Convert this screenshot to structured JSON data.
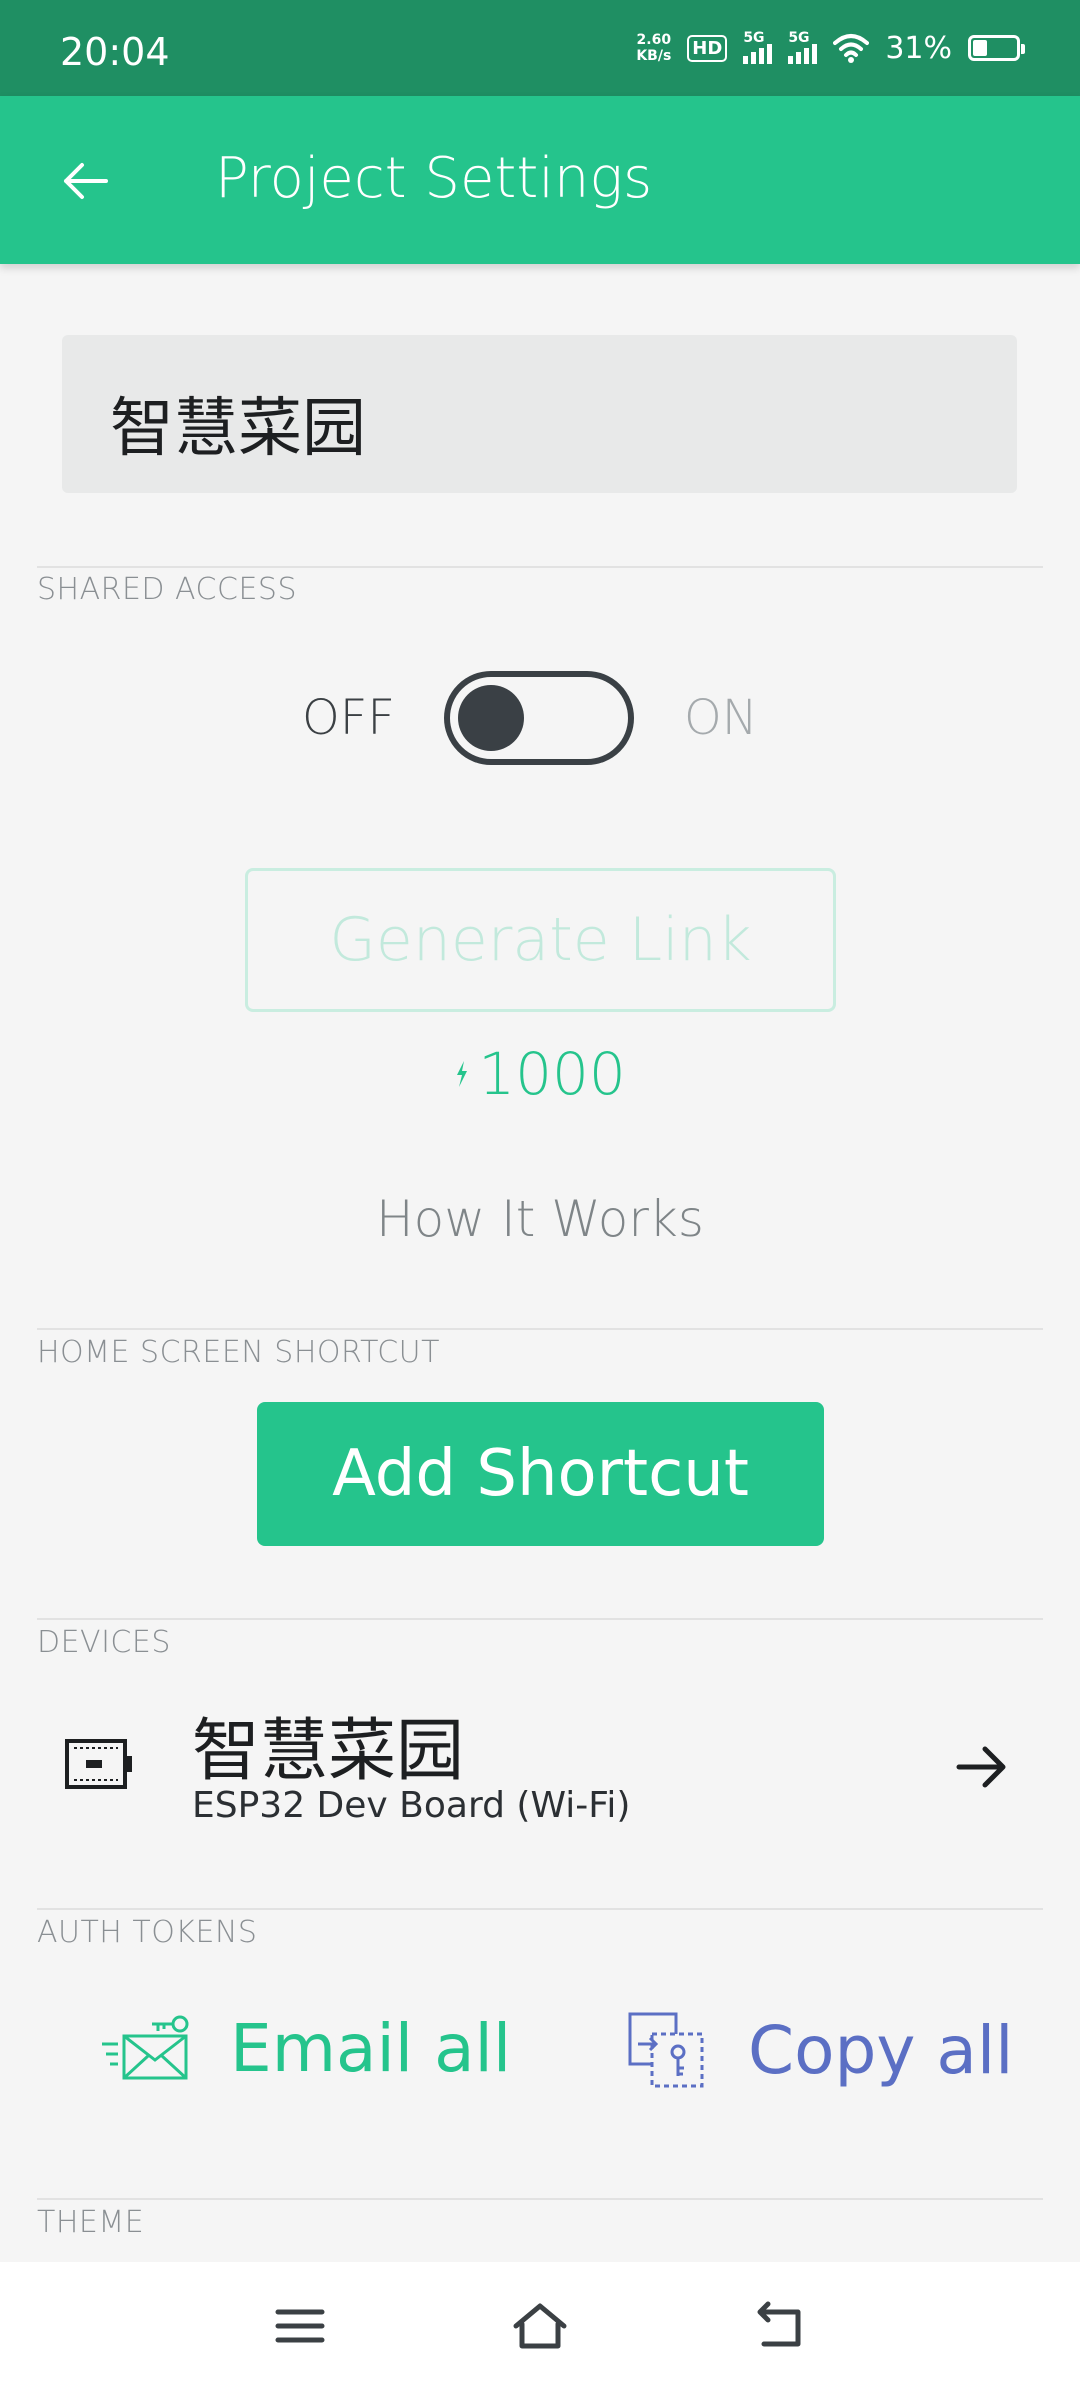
{
  "status_bar": {
    "time": "20:04",
    "net_speed_value": "2.60",
    "net_speed_unit": "KB/s",
    "hd_label": "HD",
    "sim1_label": "5G",
    "sim2_label": "5G",
    "battery": "31%"
  },
  "app_bar": {
    "title": "Project Settings",
    "back_icon": "arrow-left-icon"
  },
  "project": {
    "name": "智慧菜园"
  },
  "shared_access": {
    "section_label": "SHARED ACCESS",
    "off_label": "OFF",
    "on_label": "ON",
    "enabled": false,
    "generate_link_label": "Generate Link",
    "energy_cost": "1000",
    "how_it_works_label": "How It Works"
  },
  "home_screen_shortcut": {
    "section_label": "HOME SCREEN SHORTCUT",
    "add_shortcut_label": "Add Shortcut"
  },
  "devices": {
    "section_label": "DEVICES",
    "items": [
      {
        "name": "智慧菜园",
        "board": "ESP32 Dev Board (Wi-Fi)",
        "icon": "board-icon"
      }
    ]
  },
  "auth_tokens": {
    "section_label": "AUTH TOKENS",
    "email_all_label": "Email all",
    "copy_all_label": "Copy all"
  },
  "theme": {
    "section_label": "THEME"
  },
  "colors": {
    "status_bar": "#1f8f63",
    "accent": "#25c48c",
    "copy_blue": "#5b6fc4",
    "background": "#f5f5f5"
  }
}
